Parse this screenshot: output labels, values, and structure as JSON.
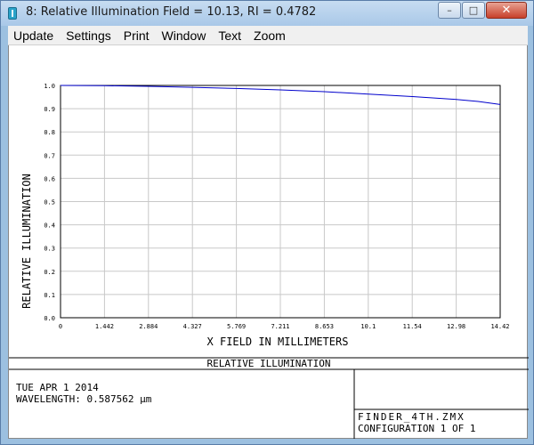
{
  "window": {
    "title": "8: Relative Illumination Field = 10.13, RI = 0.4782",
    "controls": {
      "minimize": "–",
      "maximize": "□",
      "close": "✕"
    }
  },
  "menu": {
    "items": [
      "Update",
      "Settings",
      "Print",
      "Window",
      "Text",
      "Zoom"
    ]
  },
  "chart_data": {
    "type": "line",
    "xlabel": "X FIELD IN MILLIMETERS",
    "ylabel": "RELATIVE ILLUMINATION",
    "xlim": [
      0,
      14.42
    ],
    "ylim": [
      0,
      1.0
    ],
    "x_ticks": [
      "0",
      "1.442",
      "2.884",
      "4.327",
      "5.769",
      "7.211",
      "8.653",
      "10.1",
      "11.54",
      "12.98",
      "14.42"
    ],
    "y_ticks": [
      "0.0",
      "0.1",
      "0.2",
      "0.3",
      "0.4",
      "0.5",
      "0.6",
      "0.7",
      "0.8",
      "0.9",
      "1.0"
    ],
    "grid": true,
    "series": [
      {
        "color": "#0000cc",
        "x": [
          0,
          1.442,
          2.884,
          4.327,
          5.769,
          7.211,
          8.653,
          10.1,
          11.54,
          12.98,
          13.7,
          14.42
        ],
        "y": [
          1.0,
          0.999,
          0.996,
          0.992,
          0.987,
          0.981,
          0.973,
          0.963,
          0.952,
          0.94,
          0.931,
          0.918
        ]
      }
    ]
  },
  "info": {
    "title": "RELATIVE ILLUMINATION",
    "date": "TUE APR 1 2014",
    "wavelength": "WAVELENGTH: 0.587562 µm",
    "file": "FINDER_4TH.ZMX",
    "configuration": "CONFIGURATION 1 OF 1"
  }
}
